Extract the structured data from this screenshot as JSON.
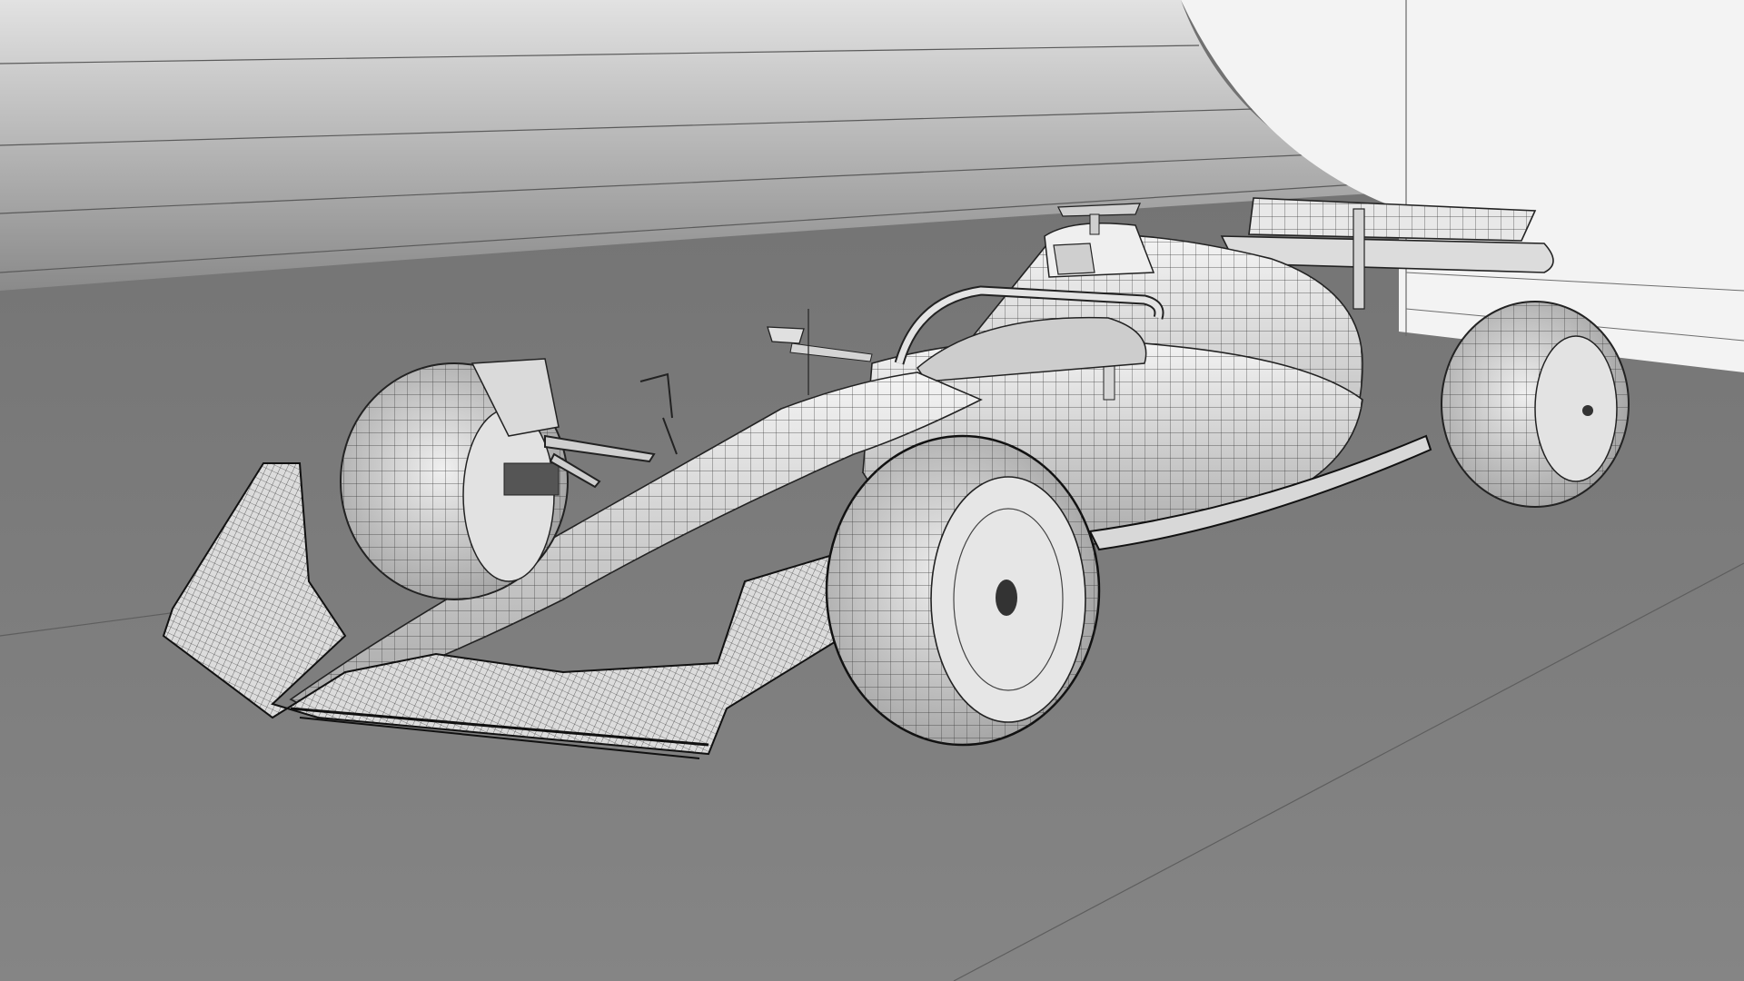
{
  "scene": {
    "subject": "formula-one-car-wireframe",
    "render_style": "wireframe-clay",
    "colors": {
      "floor": "#7f7f7f",
      "floor_far": "#737373",
      "ceiling_light": "#d8d8d8",
      "ceiling_dark": "#8e8e8e",
      "wall": "#f2f2f2",
      "body": "#e6e6e6",
      "body_shadow": "#9a9a9a",
      "wire": "#2a2a2a",
      "tyre": "#dcdcdc"
    }
  }
}
